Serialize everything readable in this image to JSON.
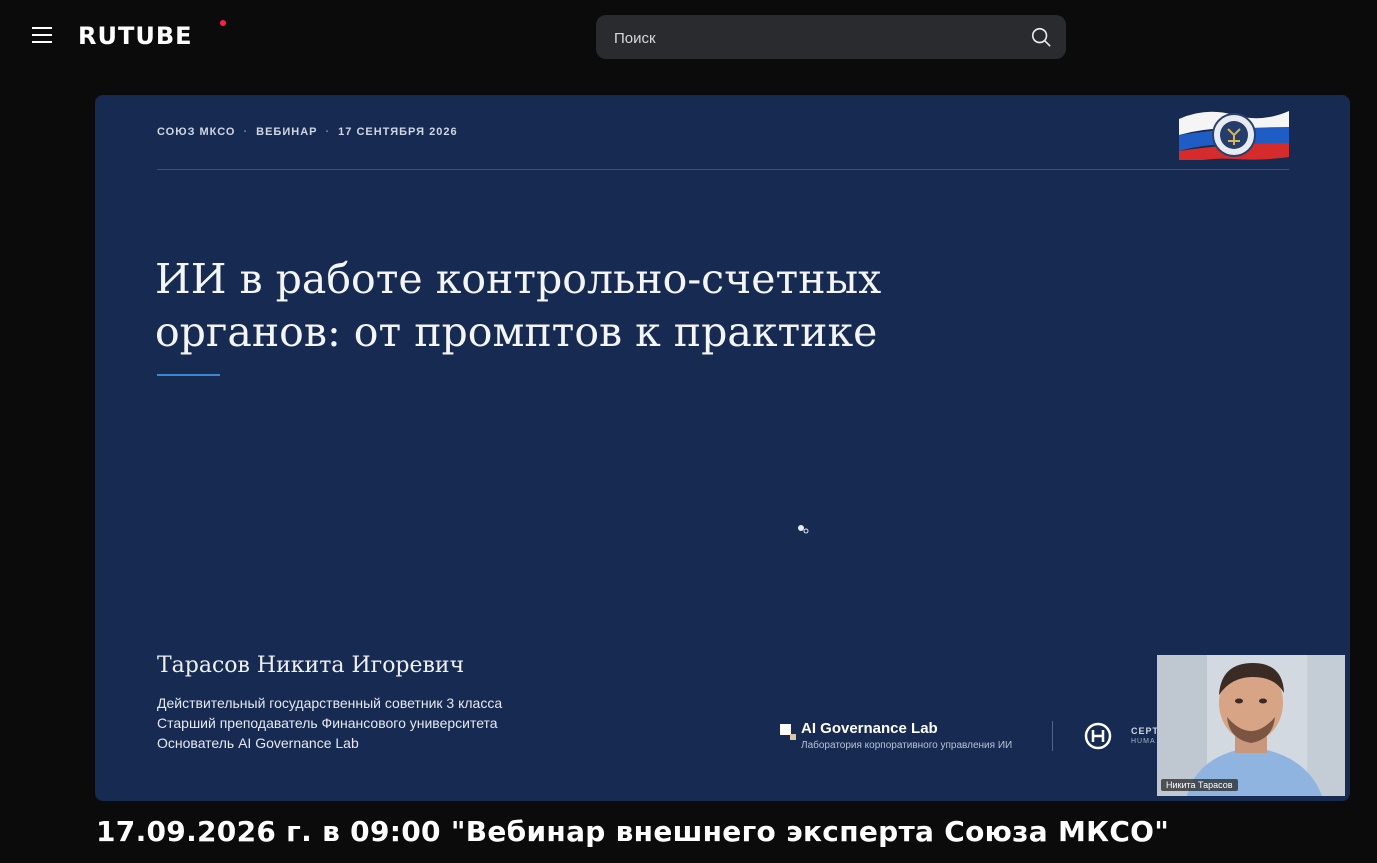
{
  "header": {
    "logo_text": "RUTUBE",
    "search_placeholder": "Поиск",
    "accent_color": "#ff1e44"
  },
  "slide": {
    "meta": [
      "СОЮЗ МКСО",
      "ВЕБИНАР",
      "17 СЕНТЯБРЯ 2026"
    ],
    "meta_separator": "·",
    "title_line1": "ИИ в работе контрольно-счетных",
    "title_line2": "органов: от промптов к практике",
    "speaker_name": "Тарасов Никита Игоревич",
    "speaker_lines": [
      "Действительный государственный советник 3 класса",
      "Старший преподаватель Финансового университета",
      "Основатель AI Governance Lab"
    ],
    "lab_name": "AI Governance Lab",
    "lab_subtitle": "Лаборатория корпоративного управления ИИ",
    "partner_text1": "СЕРТ",
    "partner_text2": "HUMA",
    "background_color": "#162a52"
  },
  "webcam": {
    "label": "Никита Тарасов"
  },
  "video": {
    "title": "17.09.2026 г. в 09:00 \"Вебинар внешнего эксперта Союза МКСО\""
  }
}
